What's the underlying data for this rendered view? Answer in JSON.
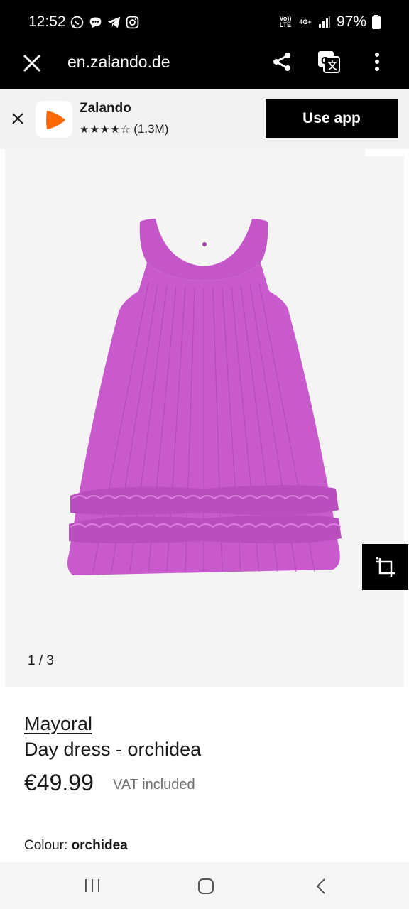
{
  "status_bar": {
    "time": "12:52",
    "icons_left": [
      "whatsapp-icon",
      "chat-bubble-icon",
      "telegram-icon",
      "instagram-icon"
    ],
    "network_top": "Vo)) LTE",
    "network_4g": "4G+",
    "battery": "97%"
  },
  "browser": {
    "url": "en.zalando.de"
  },
  "app_banner": {
    "app_name": "Zalando",
    "rating_count": "(1.3M)",
    "rating_stars": "★★★★☆",
    "use_app_label": "Use app",
    "brand_color": "#ff6900"
  },
  "gallery": {
    "counter": "1 / 3",
    "product_color": "#c456c9"
  },
  "product": {
    "brand": "Mayoral",
    "name": "Day dress - orchidea",
    "price": "€49.99",
    "vat_note": "VAT included",
    "colour_label": "Colour:",
    "colour_value": "orchidea"
  }
}
